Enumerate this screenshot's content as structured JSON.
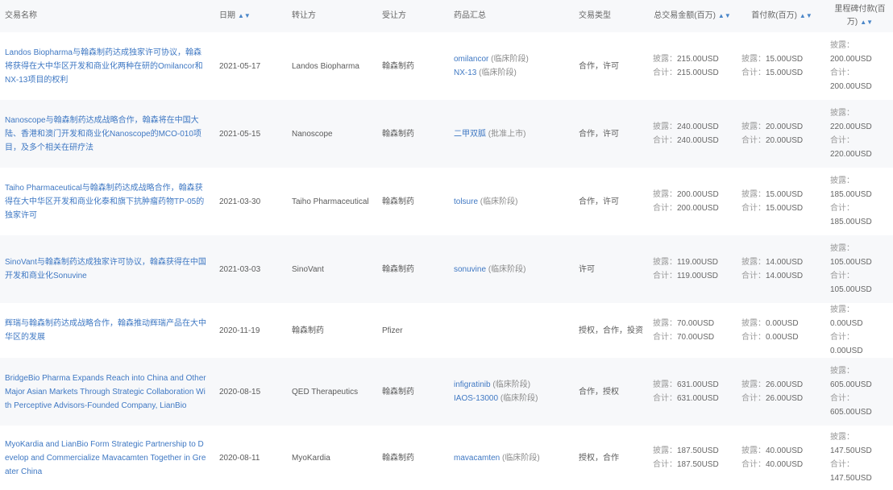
{
  "headers": {
    "title": "交易名称",
    "date": "日期",
    "licensor": "转让方",
    "licensee": "受让方",
    "product": "药品汇总",
    "type": "交易类型",
    "total": "总交易金额(百万)",
    "upfront": "首付款(百万)",
    "upfront_flat": "首付款(百万)",
    "milestone": "里程碑付款(百万)"
  },
  "labels": {
    "disclosed": "披露：",
    "total": "合计："
  },
  "rows": [
    {
      "title": "Landos Biopharma与翰森制药达成独家许可协议，翰森将获得在大中华区开发和商业化两种在研的Omilancor和NX-13项目的权利",
      "date": "2021-05-17",
      "licensor": "Landos Biopharma",
      "licensee": "翰森制药",
      "products": [
        {
          "name": "omilancor",
          "note": "(临床阶段)"
        },
        {
          "name": "NX-13",
          "note": "(临床阶段)"
        }
      ],
      "type": "合作，许可",
      "total_disclosed": "215.00USD",
      "total_sum": "215.00USD",
      "upfront_disclosed": "15.00USD",
      "upfront_sum": "15.00USD",
      "milestone_disclosed": "200.00USD",
      "milestone_sum": "200.00USD"
    },
    {
      "title": "Nanoscope与翰森制药达成战略合作，翰森将在中国大陆、香港和澳门开发和商业化Nanoscope的MCO-010项目，及多个相关在研疗法",
      "date": "2021-05-15",
      "licensor": "Nanoscope",
      "licensee": "翰森制药",
      "products": [
        {
          "name": "二甲双胍",
          "note": "(批准上市)"
        }
      ],
      "type": "合作，许可",
      "total_disclosed": "240.00USD",
      "total_sum": "240.00USD",
      "upfront_disclosed": "20.00USD",
      "upfront_sum": "20.00USD",
      "milestone_disclosed": "220.00USD",
      "milestone_sum": "220.00USD"
    },
    {
      "title": "Taiho Pharmaceutical与翰森制药达成战略合作，翰森获得在大中华区开发和商业化泰和旗下抗肿瘤药物TP-05的独家许可",
      "date": "2021-03-30",
      "licensor": "Taiho Pharmaceutical",
      "licensee": "翰森制药",
      "products": [
        {
          "name": "tolsure",
          "note": "(临床阶段)"
        }
      ],
      "type": "合作，许可",
      "total_disclosed": "200.00USD",
      "total_sum": "200.00USD",
      "upfront_disclosed": "15.00USD",
      "upfront_sum": "15.00USD",
      "milestone_disclosed": "185.00USD",
      "milestone_sum": "185.00USD"
    },
    {
      "title": "SinoVant与翰森制药达成独家许可协议，翰森获得在中国开发和商业化Sonuvine",
      "date": "2021-03-03",
      "licensor": "SinoVant",
      "licensee": "翰森制药",
      "products": [
        {
          "name": "sonuvine",
          "note": "(临床阶段)"
        }
      ],
      "type": "许可",
      "total_disclosed": "119.00USD",
      "total_sum": "119.00USD",
      "upfront_disclosed": "14.00USD",
      "upfront_sum": "14.00USD",
      "milestone_disclosed": "105.00USD",
      "milestone_sum": "105.00USD"
    },
    {
      "title": "辉瑞与翰森制药达成战略合作，翰森推动辉瑞产品在大中华区的发展",
      "date": "2020-11-19",
      "licensor": "翰森制药",
      "licensee": "Pfizer",
      "products": [],
      "type": "授权，合作，投资",
      "total_disclosed": "70.00USD",
      "total_sum": "70.00USD",
      "upfront_disclosed": "0.00USD",
      "upfront_sum": "0.00USD",
      "milestone_disclosed": "0.00USD",
      "milestone_sum": "0.00USD"
    },
    {
      "title": "BridgeBio Pharma Expands Reach into China and Other Major Asian Markets Through Strategic Collaboration With Perceptive Advisors-Founded Company, LianBio",
      "date": "2020-08-15",
      "licensor": "QED Therapeutics",
      "licensee": "翰森制药",
      "products": [
        {
          "name": "infigratinib",
          "note": "(临床阶段)"
        },
        {
          "name": "IAOS-13000",
          "note": "(临床阶段)"
        }
      ],
      "type": "合作，授权",
      "total_disclosed": "631.00USD",
      "total_sum": "631.00USD",
      "upfront_disclosed": "26.00USD",
      "upfront_sum": "26.00USD",
      "milestone_disclosed": "605.00USD",
      "milestone_sum": "605.00USD"
    },
    {
      "title": "MyoKardia and LianBio Form Strategic Partnership to Develop and Commercialize Mavacamten Together in Greater China",
      "date": "2020-08-11",
      "licensor": "MyoKardia",
      "licensee": "翰森制药",
      "products": [
        {
          "name": "mavacamten",
          "note": "(临床阶段)"
        }
      ],
      "type": "授权，合作",
      "total_disclosed": "187.50USD",
      "total_sum": "187.50USD",
      "upfront_disclosed": "40.00USD",
      "upfront_sum": "40.00USD",
      "milestone_disclosed": "147.50USD",
      "milestone_sum": "147.50USD"
    }
  ]
}
